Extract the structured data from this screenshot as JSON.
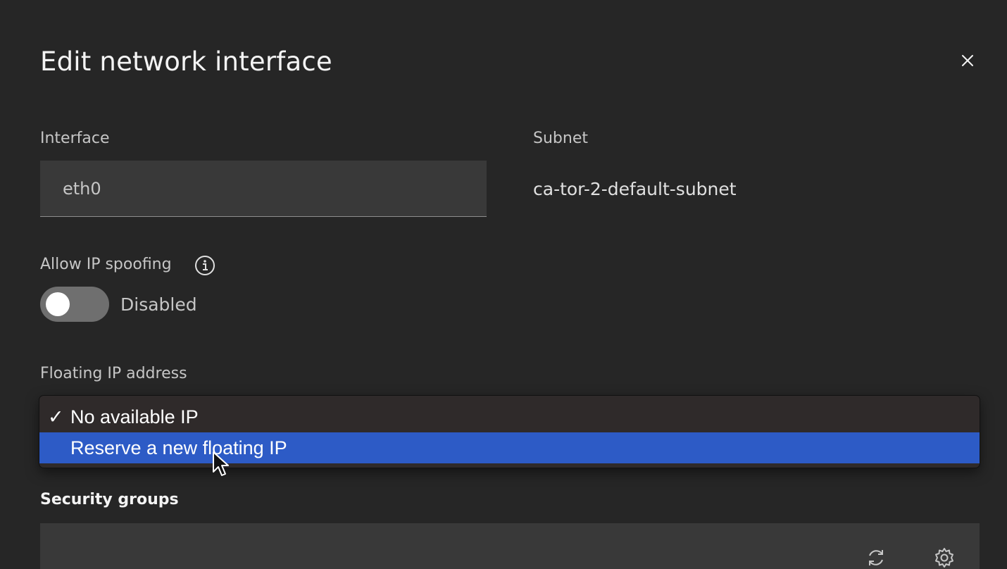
{
  "dialog": {
    "title": "Edit network interface",
    "close_icon": "close-icon"
  },
  "interface": {
    "label": "Interface",
    "value": "eth0"
  },
  "subnet": {
    "label": "Subnet",
    "value": "ca-tor-2-default-subnet"
  },
  "ip_spoofing": {
    "label": "Allow IP spoofing",
    "info_icon": "info-icon",
    "toggle_state": "off",
    "status_text": "Disabled"
  },
  "floating_ip": {
    "label": "Floating IP address",
    "options": [
      {
        "label": "No available IP",
        "checked": true,
        "highlighted": false
      },
      {
        "label": "Reserve a new floating IP",
        "checked": false,
        "highlighted": true
      }
    ],
    "check_mark": "✓"
  },
  "security_groups": {
    "label": "Security groups",
    "icons": [
      "refresh-icon",
      "gear-icon"
    ]
  },
  "colors": {
    "background": "#262626",
    "field": "#393939",
    "highlight": "#2d5bc6",
    "toggle_off": "#6f6f6f"
  }
}
